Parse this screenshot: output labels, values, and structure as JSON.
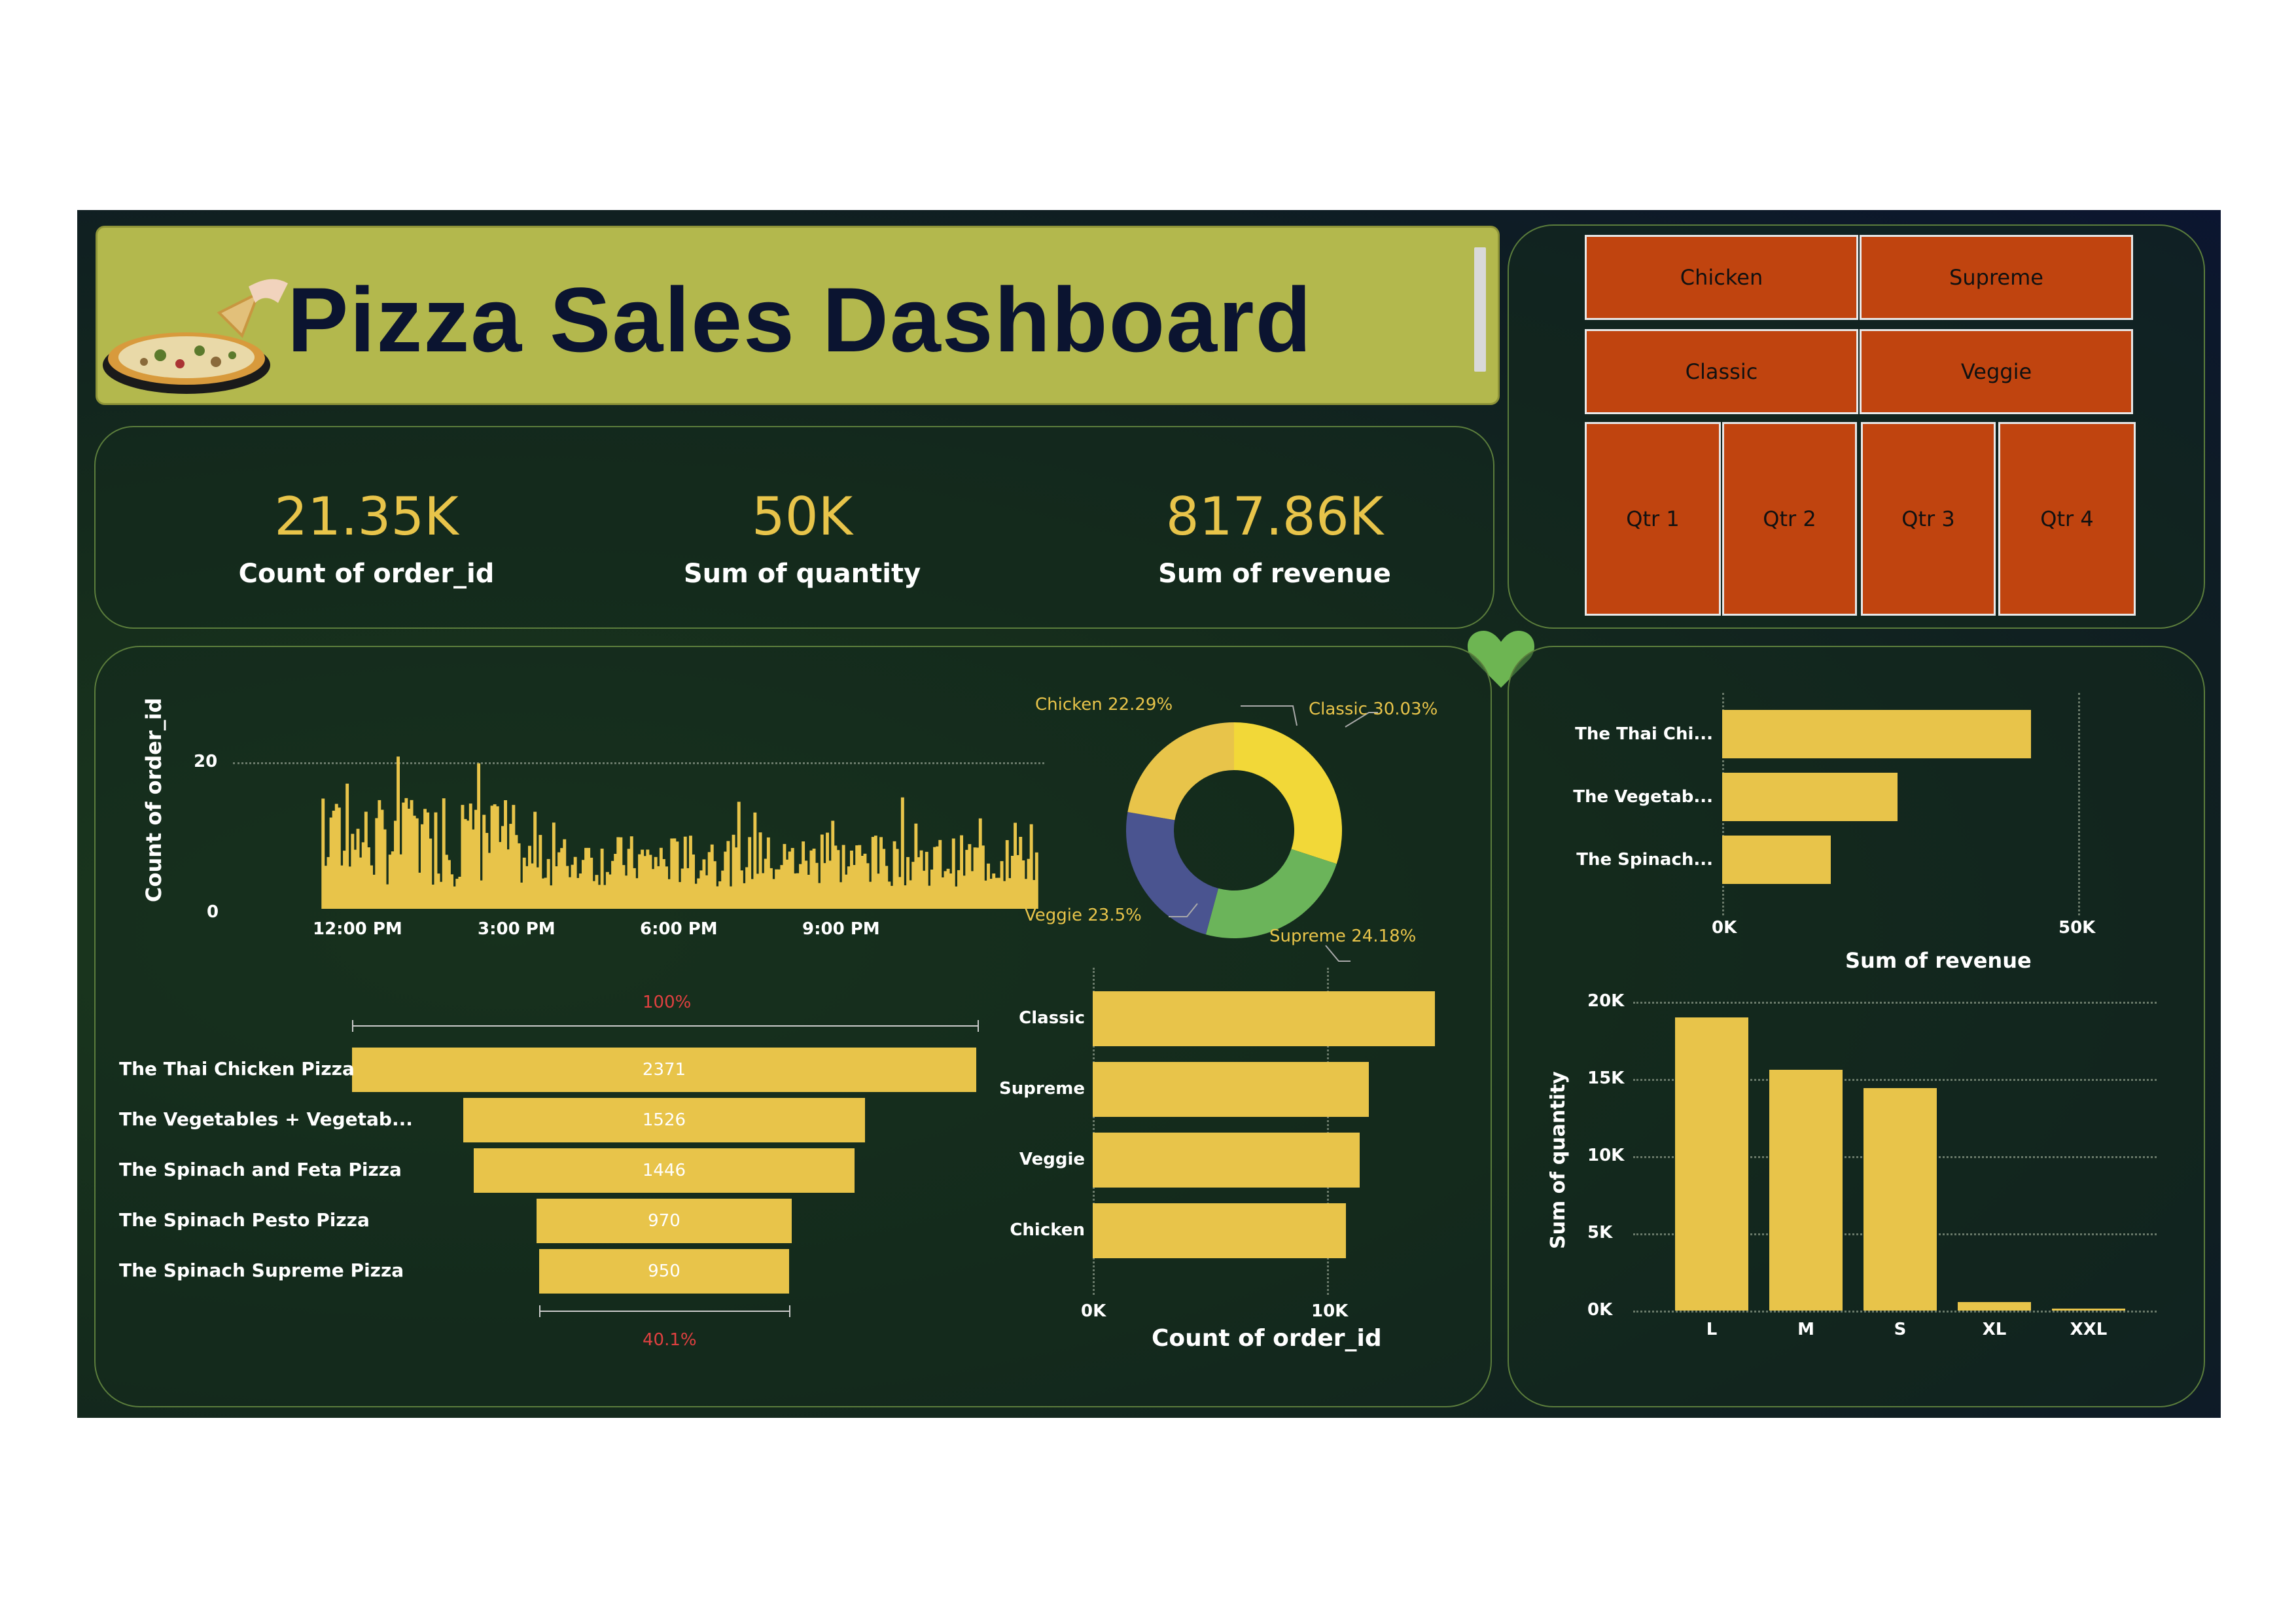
{
  "header": {
    "title": "Pizza Sales Dashboard"
  },
  "kpis": [
    {
      "value": "21.35K",
      "label": "Count of order_id"
    },
    {
      "value": "50K",
      "label": "Sum of quantity"
    },
    {
      "value": "817.86K",
      "label": "Sum of revenue"
    }
  ],
  "slicers": {
    "categories": [
      "Chicken",
      "Supreme",
      "Classic",
      "Veggie"
    ],
    "quarters": [
      "Qtr 1",
      "Qtr 2",
      "Qtr 3",
      "Qtr 4"
    ]
  },
  "colors": {
    "accent": "#e8c44a",
    "slicer": "#c0440f",
    "banner": "#b3b84d",
    "pct_red": "#e04040"
  },
  "chart_data": [
    {
      "type": "area",
      "ylabel": "Count of order_id",
      "yticks": [
        "20",
        "0"
      ],
      "xticks": [
        "12:00 PM",
        "3:00 PM",
        "6:00 PM",
        "9:00 PM"
      ],
      "ylim": [
        0,
        22
      ],
      "note_series": "orders per minute, approximate envelope",
      "grid": true
    },
    {
      "type": "pie",
      "slices": [
        {
          "name": "Classic",
          "value": 30.03,
          "label": "Classic 30.03%",
          "color": "#f2d838"
        },
        {
          "name": "Supreme",
          "value": 24.18,
          "label": "Supreme 24.18%",
          "color": "#6bb45a"
        },
        {
          "name": "Veggie",
          "value": 23.5,
          "label": "Veggie 23.5%",
          "color": "#4a5490"
        },
        {
          "name": "Chicken",
          "value": 22.29,
          "label": "Chicken 22.29%",
          "color": "#e8c44a"
        }
      ]
    },
    {
      "type": "bar",
      "orientation": "horizontal",
      "categories": [
        "The Thai Chi...",
        "The Vegetab...",
        "The Spinach..."
      ],
      "values": [
        43400,
        24600,
        15300
      ],
      "xticks": [
        "0K",
        "50K"
      ],
      "xlabel": "Sum of revenue",
      "xlim": [
        0,
        50000
      ]
    },
    {
      "type": "bar",
      "orientation": "funnel",
      "categories": [
        "The Thai Chicken Pizza",
        "The Vegetables + Vegetab...",
        "The Spinach and Feta Pizza",
        "The Spinach Pesto Pizza",
        "The Spinach Supreme Pizza"
      ],
      "values": [
        2371,
        1526,
        1446,
        970,
        950
      ],
      "value_labels": [
        "2371",
        "1526",
        "1446",
        "970",
        "950"
      ],
      "top_pct": "100%",
      "bottom_pct": "40.1%"
    },
    {
      "type": "bar",
      "orientation": "horizontal",
      "categories": [
        "Classic",
        "Supreme",
        "Veggie",
        "Chicken"
      ],
      "values": [
        14600,
        11800,
        11400,
        10800
      ],
      "xticks": [
        "0K",
        "10K"
      ],
      "xlabel": "Count of order_id",
      "xlim": [
        0,
        14600
      ]
    },
    {
      "type": "bar",
      "categories": [
        "L",
        "M",
        "S",
        "XL",
        "XXL"
      ],
      "values": [
        19000,
        15600,
        14400,
        550,
        30
      ],
      "yticks": [
        "20K",
        "15K",
        "10K",
        "5K",
        "0K"
      ],
      "ylabel": "Sum of quantity",
      "ylim": [
        0,
        20000
      ]
    }
  ]
}
